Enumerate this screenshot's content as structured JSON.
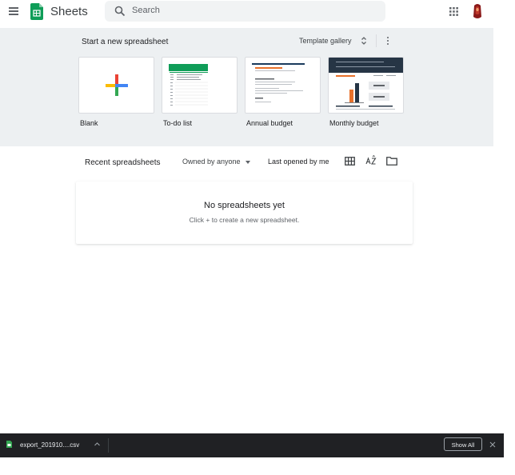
{
  "header": {
    "app_name": "Sheets",
    "search_placeholder": "Search"
  },
  "templates": {
    "title": "Start a new spreadsheet",
    "gallery_label": "Template gallery",
    "items": [
      {
        "label": "Blank"
      },
      {
        "label": "To-do list"
      },
      {
        "label": "Annual budget"
      },
      {
        "label": "Monthly budget"
      }
    ]
  },
  "recent": {
    "title": "Recent spreadsheets",
    "owner_filter": "Owned by anyone",
    "sort_label": "Last opened by me"
  },
  "empty_state": {
    "title": "No spreadsheets yet",
    "subtitle": "Click + to create a new spreadsheet."
  },
  "download_bar": {
    "file_name": "export_201910....csv",
    "show_all_label": "Show All"
  },
  "colors": {
    "sheets_green": "#0f9d58",
    "band_bg": "#edf0f2",
    "plus_red": "#ea4335",
    "plus_blue": "#4285f4",
    "plus_yellow": "#fbbc04",
    "plus_green": "#34a853"
  }
}
